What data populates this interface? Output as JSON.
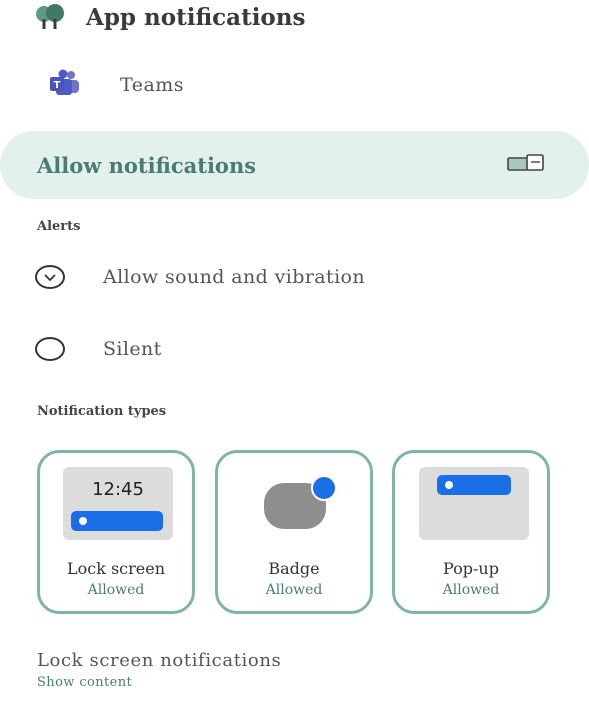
{
  "header": {
    "title": "App notifications",
    "icon": "tree-icon"
  },
  "app": {
    "name": "Teams",
    "icon": "teams-icon"
  },
  "allow": {
    "label": "Allow notifications",
    "toggle_icon": "toggle-icon"
  },
  "alerts": {
    "section_label": "Alerts",
    "options": [
      {
        "label": "Allow sound and vibration",
        "selected": true
      },
      {
        "label": "Silent",
        "selected": false
      }
    ]
  },
  "types": {
    "section_label": "Notification types",
    "lock_screen": {
      "preview_time": "12:45",
      "name": "Lock screen",
      "status": "Allowed"
    },
    "badge": {
      "name": "Badge",
      "status": "Allowed"
    },
    "popup": {
      "name": "Pop-up",
      "status": "Allowed"
    }
  },
  "lock_notifications": {
    "title": "Lock screen notifications",
    "value": "Show content"
  },
  "colors": {
    "accent": "#4a7c72",
    "bar_bg": "#e2f0ee",
    "card_border": "#7fb5a8",
    "blue": "#1a6ee8"
  }
}
